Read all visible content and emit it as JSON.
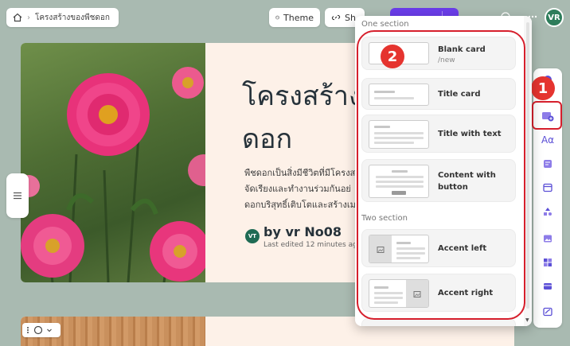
{
  "breadcrumb": {
    "page": "โครงสร้างของพืชดอก"
  },
  "toolbar": {
    "theme_label": "Theme",
    "share_label": "Sh"
  },
  "user": {
    "initials": "VR"
  },
  "slide": {
    "title": "โครงสร้าง\nดอก",
    "body": "พืชดอกเป็นสิ่งมีชีวิตที่มีโครงส\nจัดเรียงและทำงานร่วมกันอย่\nดอกบริสุทธิ์เติบโตและสร้างเม",
    "author_initials": "VT",
    "author": "by vr No08",
    "edited": "Last edited 12 minutes ago"
  },
  "panel": {
    "section_one": "One section",
    "section_two": "Two section",
    "options": [
      {
        "label": "Blank card",
        "sub": "/new"
      },
      {
        "label": "Title card"
      },
      {
        "label": "Title with text"
      },
      {
        "label": "Content with\nbutton"
      },
      {
        "label": "Accent left"
      },
      {
        "label": "Accent right"
      }
    ]
  },
  "annotations": {
    "step_one": "1",
    "step_two": "2"
  },
  "rail": {
    "text_icon_label": "Aα"
  },
  "colors": {
    "accent": "#6a3de8",
    "highlight": "#d61f2c",
    "badge": "#e5342f"
  }
}
